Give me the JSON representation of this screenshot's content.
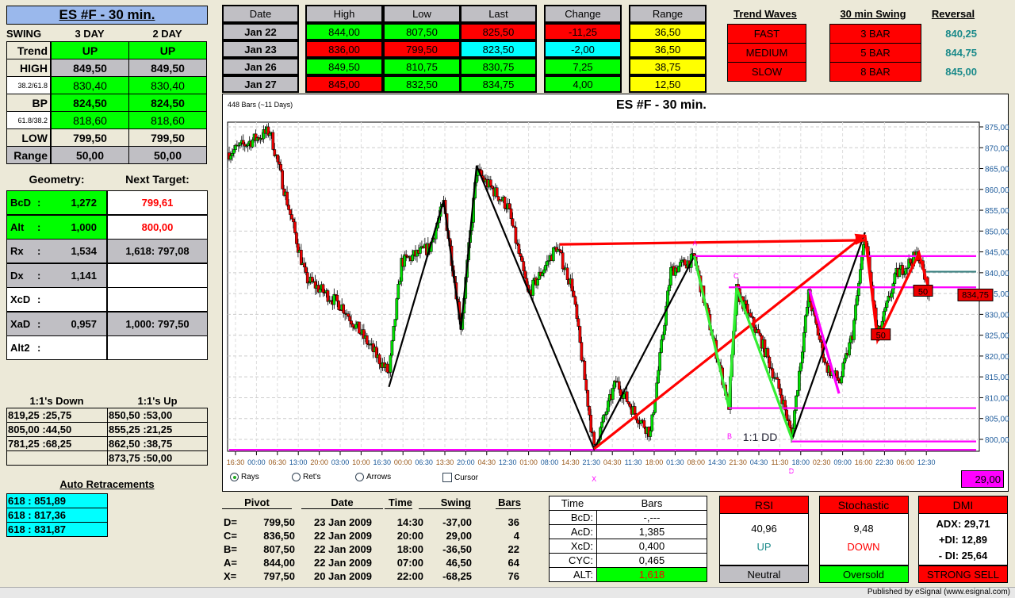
{
  "left": {
    "title": "ES #F - 30 min.",
    "swing_header": [
      "SWING",
      "3 DAY",
      "2 DAY"
    ],
    "swing_rows": [
      {
        "label": "Trend",
        "v": [
          "UP",
          "UP"
        ],
        "lbg": "#ece9d8",
        "vbg": "#00ff00",
        "bold": true
      },
      {
        "label": "HIGH",
        "v": [
          "849,50",
          "849,50"
        ],
        "lbg": "#ece9d8",
        "vbg": "#c0bfc4",
        "bold": true
      },
      {
        "label": "38.2/61.8",
        "v": [
          "830,40",
          "830,40"
        ],
        "lbg": "#ffffff",
        "vbg": "#00ff00",
        "bold": false,
        "small": true
      },
      {
        "label": "BP",
        "v": [
          "824,50",
          "824,50"
        ],
        "lbg": "#ece9d8",
        "vbg": "#00ff00",
        "bold": true
      },
      {
        "label": "61.8/38.2",
        "v": [
          "818,60",
          "818,60"
        ],
        "lbg": "#ffffff",
        "vbg": "#00ff00",
        "bold": false,
        "small": true
      },
      {
        "label": "LOW",
        "v": [
          "799,50",
          "799,50"
        ],
        "lbg": "#ece9d8",
        "vbg": "#ece9d8",
        "bold": true
      },
      {
        "label": "Range",
        "v": [
          "50,00",
          "50,00"
        ],
        "lbg": "#c0bfc4",
        "vbg": "#c0bfc4",
        "bold": true
      }
    ],
    "geometry_heading": "Geometry:",
    "target_heading": "Next Target:",
    "geometry_rows": [
      {
        "label": "BcD",
        "value": "1,272",
        "target": "799,61",
        "bg": "#00ff00",
        "tbg": "#ffffff",
        "tcolor": "#ff0000"
      },
      {
        "label": "Alt",
        "value": "1,000",
        "target": "800,00",
        "bg": "#00ff00",
        "tbg": "#ffffff",
        "tcolor": "#ff0000"
      },
      {
        "label": "Rx",
        "value": "1,534",
        "target": "1,618: 797,08",
        "bg": "#c0bfc4",
        "tbg": "#c0bfc4",
        "tcolor": "#000000"
      },
      {
        "label": "Dx",
        "value": "1,141",
        "target": "",
        "bg": "#c0bfc4",
        "tbg": "#ffffff",
        "tcolor": "#000000"
      },
      {
        "label": "XcD",
        "value": "",
        "target": "",
        "bg": "#ffffff",
        "tbg": "#ffffff",
        "tcolor": "#000000"
      },
      {
        "label": "XaD",
        "value": "0,957",
        "target": "1,000: 797,50",
        "bg": "#c0bfc4",
        "tbg": "#c0bfc4",
        "tcolor": "#000000"
      },
      {
        "label": "Alt2",
        "value": "",
        "target": "",
        "bg": "#ffffff",
        "tbg": "#ffffff",
        "tcolor": "#000000"
      }
    ],
    "colon": ":",
    "ones_down_heading": "1:1's Down",
    "ones_up_heading": "1:1's Up",
    "ones_down": [
      "819,25 :25,75",
      "805,00 :44,50",
      "781,25 :68,25",
      ""
    ],
    "ones_up": [
      "850,50 :53,00",
      "855,25 :21,25",
      "862,50 :38,75",
      "873,75 :50,00"
    ],
    "retrace_heading": "Auto Retracements",
    "retracements": [
      "618 : 851,89",
      "618 : 817,36",
      "618 : 831,87"
    ]
  },
  "quotes": {
    "headers": [
      "Date",
      "High",
      "Low",
      "Last",
      "Change",
      "Range"
    ],
    "rows": [
      {
        "date": "Jan  22",
        "high": "844,00",
        "low": "807,50",
        "last": "825,50",
        "change": "-11,25",
        "range": "36,50",
        "colors": [
          "#00ff00",
          "#00ff00",
          "#ff0000",
          "#ff0000",
          "#ffff00"
        ]
      },
      {
        "date": "Jan  23",
        "high": "836,00",
        "low": "799,50",
        "last": "823,50",
        "change": "-2,00",
        "range": "36,50",
        "colors": [
          "#ff0000",
          "#ff0000",
          "#00ffff",
          "#00ffff",
          "#ffff00"
        ]
      },
      {
        "date": "Jan  26",
        "high": "849,50",
        "low": "810,75",
        "last": "830,75",
        "change": "7,25",
        "range": "38,75",
        "colors": [
          "#00ff00",
          "#00ff00",
          "#00ff00",
          "#00ff00",
          "#ffff00"
        ]
      },
      {
        "date": "Jan  27",
        "high": "845,00",
        "low": "832,50",
        "last": "834,75",
        "change": "4,00",
        "range": "12,50",
        "colors": [
          "#ff0000",
          "#00ff00",
          "#00ff00",
          "#00ff00",
          "#ffff00"
        ]
      }
    ]
  },
  "waves": {
    "trend_heading": "Trend Waves",
    "swing_heading": "30 min Swing",
    "reversal_heading": "Reversal",
    "trend": [
      "FAST",
      "MEDIUM",
      "SLOW"
    ],
    "swing": [
      "3 BAR",
      "5 BAR",
      "8 BAR"
    ],
    "reversal": [
      "840,25",
      "844,75",
      "845,00"
    ],
    "reversal_color": "#1a8a8a"
  },
  "chart": {
    "bars_info": "448 Bars (~11 Days)",
    "title": "ES #F - 30 min.",
    "last_price_tag": "834,75",
    "value_box": "29,00",
    "options": {
      "rays": "Rays",
      "rets": "Ret's",
      "arrows": "Arrows",
      "cursor": "Cursor"
    },
    "labels": {
      "A": "A",
      "B": "B",
      "C": "C",
      "X": "X",
      "D": "D",
      "dd": "1:1 DD",
      "fifty": "50"
    }
  },
  "chart_data": {
    "type": "candlestick",
    "title": "ES #F - 30 min.",
    "bar_count": 448,
    "ylim": [
      797,
      877
    ],
    "y_ticks": [
      "875,00",
      "870,00",
      "865,00",
      "860,00",
      "855,00",
      "850,00",
      "845,00",
      "840,00",
      "835,00",
      "830,00",
      "825,00",
      "820,00",
      "815,00",
      "810,00",
      "805,00",
      "800,00"
    ],
    "y_tick_values": [
      875,
      870,
      865,
      860,
      855,
      850,
      845,
      840,
      835,
      830,
      825,
      820,
      815,
      810,
      805,
      800
    ],
    "x_ticks": [
      "16:30",
      "00:00",
      "06:30",
      "13:00",
      "20:00",
      "03:00",
      "10:00",
      "16:30",
      "00:00",
      "06:30",
      "13:30",
      "20:00",
      "04:30",
      "12:30",
      "01:00",
      "08:00",
      "14:30",
      "21:30",
      "04:30",
      "11:30",
      "18:00",
      "01:30",
      "08:00",
      "14:30",
      "21:30",
      "04:30",
      "11:30",
      "18:00",
      "02:30",
      "09:00",
      "16:00",
      "22:30",
      "06:00",
      "12:30"
    ],
    "price_path_pivots": [
      [
        1,
        869
      ],
      [
        26,
        874
      ],
      [
        49,
        838.6
      ],
      [
        72,
        832
      ],
      [
        102,
        815.8
      ],
      [
        110,
        842.5
      ],
      [
        128,
        846
      ],
      [
        137,
        856.7
      ],
      [
        148,
        827.2
      ],
      [
        158,
        864.3
      ],
      [
        178,
        855.8
      ],
      [
        191,
        834.8
      ],
      [
        209,
        846.2
      ],
      [
        219,
        836.7
      ],
      [
        233,
        797.7
      ],
      [
        247,
        813.9
      ],
      [
        259,
        806.3
      ],
      [
        269,
        801.5
      ],
      [
        282,
        840.5
      ],
      [
        297,
        843.4
      ],
      [
        307,
        827.2
      ],
      [
        319,
        808.2
      ],
      [
        324,
        835.8
      ],
      [
        340,
        823.4
      ],
      [
        353,
        810.1
      ],
      [
        359,
        800.6
      ],
      [
        370,
        834.8
      ],
      [
        381,
        817.7
      ],
      [
        390,
        813.9
      ],
      [
        398,
        825.3
      ],
      [
        406,
        849.1
      ],
      [
        414,
        824.4
      ],
      [
        426,
        839.6
      ],
      [
        440,
        844.4
      ],
      [
        447,
        834.8
      ]
    ],
    "overlays": [
      {
        "name": "black-zigzag",
        "color": "#000000",
        "points": [
          [
            102,
            812.6
          ],
          [
            137,
            857.3
          ],
          [
            148,
            826.3
          ],
          [
            158,
            865.7
          ],
          [
            233,
            797.7
          ],
          [
            297,
            844
          ]
        ]
      },
      {
        "name": "black-leg",
        "color": "#000000",
        "points": [
          [
            359.5,
            800
          ],
          [
            406,
            849.7
          ]
        ]
      },
      {
        "name": "red-arrow-diagonal",
        "color": "#ff0000",
        "points": [
          [
            233,
            797.7
          ],
          [
            406,
            849.1
          ]
        ]
      },
      {
        "name": "red-arrow-horizontal",
        "color": "#ff0000",
        "points": [
          [
            211,
            846.8
          ],
          [
            406,
            847.8
          ]
        ]
      },
      {
        "name": "red-swing",
        "color": "#ff0000",
        "points": [
          [
            406,
            849.1
          ],
          [
            414,
            823.8
          ],
          [
            440.5,
            844.7
          ],
          [
            447.6,
            834.8
          ]
        ]
      },
      {
        "name": "green-pattern",
        "color": "#33ee33",
        "points": [
          [
            297,
            844
          ],
          [
            319,
            807.8
          ],
          [
            324,
            836.4
          ],
          [
            359.5,
            800
          ]
        ]
      },
      {
        "name": "magenta-leg",
        "color": "#ff00ff",
        "points": [
          [
            370.6,
            835.8
          ],
          [
            389.4,
            811
          ]
        ]
      }
    ],
    "levels": [
      {
        "price": 844,
        "from": 297,
        "color": "#ff00ff"
      },
      {
        "price": 836.5,
        "from": 319,
        "color": "#ff00ff"
      },
      {
        "price": 807.5,
        "from": 319,
        "color": "#ff00ff"
      },
      {
        "price": 799.5,
        "from": 359.5,
        "color": "#ff00ff"
      },
      {
        "price": 797.5,
        "from": 0,
        "color": "#ff00ff"
      },
      {
        "price": 840.25,
        "from": 445,
        "color": "#3a8080"
      }
    ],
    "last_price": 834.75
  },
  "pivots": {
    "headers": [
      "Pivot",
      "Date",
      "Time",
      "Swing",
      "Bars"
    ],
    "rows": [
      {
        "label": "D=",
        "pivot": "799,50",
        "date": "23  Jan  2009",
        "time": "14:30",
        "swing": "-37,00",
        "bars": "36"
      },
      {
        "label": "C=",
        "pivot": "836,50",
        "date": "22  Jan  2009",
        "time": "20:00",
        "swing": "29,00",
        "bars": "4"
      },
      {
        "label": "B=",
        "pivot": "807,50",
        "date": "22  Jan  2009",
        "time": "18:00",
        "swing": "-36,50",
        "bars": "22"
      },
      {
        "label": "A=",
        "pivot": "844,00",
        "date": "22  Jan  2009",
        "time": "07:00",
        "swing": "46,50",
        "bars": "64"
      },
      {
        "label": "X=",
        "pivot": "797,50",
        "date": "20  Jan  2009",
        "time": "22:00",
        "swing": "-68,25",
        "bars": "76"
      }
    ]
  },
  "timebars": {
    "headers": [
      "Time",
      "Bars"
    ],
    "rows": [
      {
        "label": "BcD:",
        "value": "-,---"
      },
      {
        "label": "AcD:",
        "value": "1,385"
      },
      {
        "label": "XcD:",
        "value": "0,400"
      },
      {
        "label": "CYC:",
        "value": "0,465"
      },
      {
        "label": "ALT:",
        "value": "1,618"
      }
    ]
  },
  "indicators": [
    {
      "title": "RSI",
      "lines": [
        "40,96",
        "UP"
      ],
      "line_colors": [
        "#000000",
        "#1a8a8a"
      ],
      "status": "Neutral",
      "status_bg": "#c0bfc4"
    },
    {
      "title": "Stochastic",
      "lines": [
        "9,48",
        "DOWN"
      ],
      "line_colors": [
        "#000000",
        "#ff0000"
      ],
      "status": "Oversold",
      "status_bg": "#00ff00"
    },
    {
      "title": "DMI",
      "lines": [
        "ADX:  29,71",
        "+DI:  12,89",
        "- DI:  25,64"
      ],
      "line_colors": [
        "#000000",
        "#000000",
        "#000000"
      ],
      "status": "STRONG SELL",
      "status_bg": "#ff0000"
    }
  ],
  "footer": "Published by eSignal (www.esignal.com)"
}
